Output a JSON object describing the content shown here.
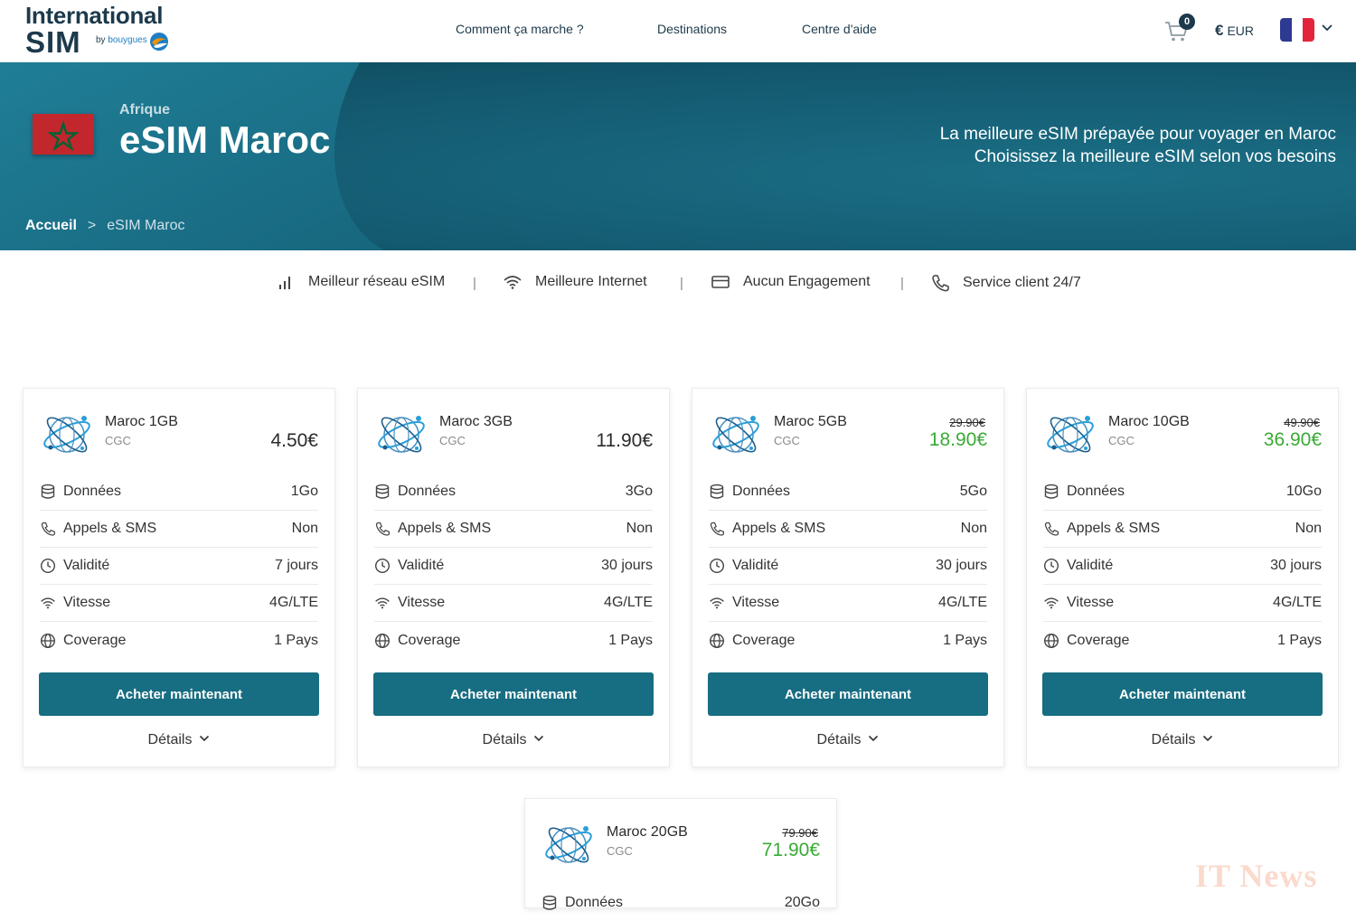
{
  "header": {
    "logo_line1": "International",
    "logo_line2": "SIM",
    "logo_by": "by",
    "logo_brand": "bouygues",
    "nav": [
      "Comment ça marche ?",
      "Destinations",
      "Centre d'aide"
    ],
    "cart_count": "0",
    "currency_symbol": "€",
    "currency": "EUR"
  },
  "hero": {
    "region": "Afrique",
    "title": "eSIM Maroc",
    "tagline1": "La meilleure eSIM prépayée pour voyager en Maroc",
    "tagline2": "Choisissez la meilleure eSIM selon vos besoins",
    "breadcrumb_home": "Accueil",
    "breadcrumb_sep": ">",
    "breadcrumb_current": "eSIM Maroc"
  },
  "features": [
    {
      "icon": "signal-icon",
      "label": "Meilleur réseau eSIM"
    },
    {
      "icon": "wifi-icon",
      "label": "Meilleure Internet"
    },
    {
      "icon": "card-icon",
      "label": "Aucun Engagement"
    },
    {
      "icon": "phone-icon",
      "label": "Service client 24/7"
    }
  ],
  "feature_separator": "|",
  "spec_labels": {
    "data": "Données",
    "calls": "Appels & SMS",
    "validity": "Validité",
    "speed": "Vitesse",
    "coverage": "Coverage"
  },
  "plans": [
    {
      "name": "Maroc 1GB",
      "cgc": "CGC",
      "old_price": "",
      "price": "4.50€",
      "data": "1Go",
      "calls": "Non",
      "validity": "7 jours",
      "speed": "4G/LTE",
      "coverage": "1 Pays",
      "buy_label": "Acheter maintenant",
      "details_label": "Détails"
    },
    {
      "name": "Maroc 3GB",
      "cgc": "CGC",
      "old_price": "",
      "price": "11.90€",
      "data": "3Go",
      "calls": "Non",
      "validity": "30 jours",
      "speed": "4G/LTE",
      "coverage": "1 Pays",
      "buy_label": "Acheter maintenant",
      "details_label": "Détails"
    },
    {
      "name": "Maroc 5GB",
      "cgc": "CGC",
      "old_price": "29.90€",
      "price": "18.90€",
      "data": "5Go",
      "calls": "Non",
      "validity": "30 jours",
      "speed": "4G/LTE",
      "coverage": "1 Pays",
      "buy_label": "Acheter maintenant",
      "details_label": "Détails"
    },
    {
      "name": "Maroc 10GB",
      "cgc": "CGC",
      "old_price": "49.90€",
      "price": "36.90€",
      "data": "10Go",
      "calls": "Non",
      "validity": "30 jours",
      "speed": "4G/LTE",
      "coverage": "1 Pays",
      "buy_label": "Acheter maintenant",
      "details_label": "Détails"
    },
    {
      "name": "Maroc 20GB",
      "cgc": "CGC",
      "old_price": "79.90€",
      "price": "71.90€",
      "data": "20Go"
    }
  ],
  "watermark": "IT News",
  "colors": {
    "primary": "#176d81",
    "hero_bg": "#145c72",
    "promo_green": "#3aaa35",
    "navy": "#1d3a4c",
    "morocco_red": "#c1272d",
    "morocco_green": "#006233"
  }
}
